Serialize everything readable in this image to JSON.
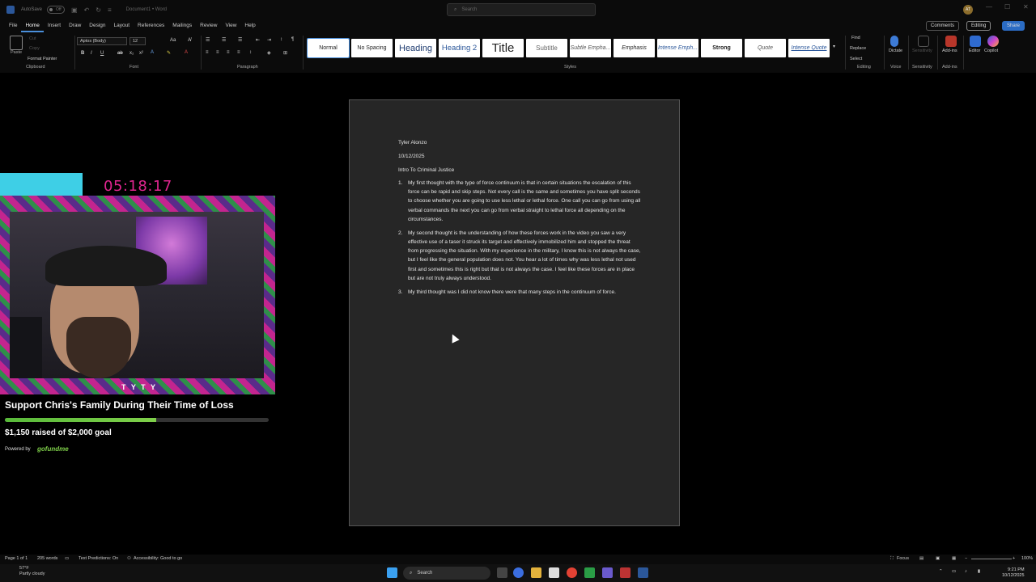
{
  "titlebar": {
    "autosave_label": "AutoSave",
    "autosave_state": "Off",
    "doc_title": "Document1 • Word",
    "search_placeholder": "Search",
    "user_initials": "AT"
  },
  "tabs": [
    "File",
    "Home",
    "Insert",
    "Draw",
    "Design",
    "Layout",
    "References",
    "Mailings",
    "Review",
    "View",
    "Help"
  ],
  "active_tab": "Home",
  "right_buttons": {
    "comments": "Comments",
    "editing": "Editing",
    "share": "Share"
  },
  "ribbon": {
    "paste": "Paste",
    "cut": "Cut",
    "copy": "Copy",
    "format_painter": "Format Painter",
    "clipboard_label": "Clipboard",
    "font_name": "Aptos (Body)",
    "font_size": "12",
    "font_label": "Font",
    "paragraph_label": "Paragraph",
    "styles_label": "Styles",
    "styles": [
      "Normal",
      "No Spacing",
      "Heading",
      "Heading 2",
      "Title",
      "Subtitle",
      "Subtle Empha...",
      "Emphasis",
      "Intense Emph...",
      "Strong",
      "Quote",
      "Intense Quote"
    ],
    "find": "Find",
    "replace": "Replace",
    "select": "Select",
    "editing_label": "Editing",
    "dictate": "Dictate",
    "voice_label": "Voice",
    "sensitivity": "Sensitivity",
    "sensitivity_label": "Sensitivity",
    "addins": "Add-ins",
    "addins_label": "Add-ins",
    "editor": "Editor",
    "copilot": "Copilot"
  },
  "document": {
    "name": "Tyler Alonzo",
    "date": "10/12/2025",
    "course": "Intro To Criminal Justice",
    "items": [
      {
        "num": "1.",
        "text": "My first thought with the type of force continuum is that in certain situations the escalation of this force can be rapid and skip steps. Not every call is the same and sometimes you have split seconds to choose whether you are going to use less lethal or lethal force. One call you can go from using all verbal commands the next you can go from verbal straight to lethal force all depending on the circumstances."
      },
      {
        "num": "2.",
        "text": "My second thought is the understanding of how these forces work in the video you saw a very effective use of a taser it struck its target and effectively immobilized him and stopped the threat from progressing the situation. With my experience in the military, I know this is not always the case, but I feel like the general population does not. You hear a lot of times why was less lethal not used first and sometimes this is right but that is not always the case. I feel like these forces are in place but are not truly always understood."
      },
      {
        "num": "3.",
        "text": "My third thought was I did not know there were that many steps in the continuum of force."
      }
    ]
  },
  "overlay": {
    "timer": "05:18:17",
    "fundraiser_title": "Support Chris's Family During Their Time of Loss",
    "raised_text": "$1,150 raised of $2,000 goal",
    "raised_fraction": 0.575,
    "powered_by": "Powered by",
    "logo": "gofundme",
    "cam_caption": "T Y T Y"
  },
  "statusbar": {
    "page": "Page 1 of 1",
    "words": "205 words",
    "text_predictions": "Text Predictions: On",
    "accessibility": "Accessibility: Good to go",
    "focus": "Focus",
    "zoom": "100%"
  },
  "taskbar": {
    "temp": "57°F",
    "weather": "Partly cloudy",
    "search": "Search",
    "time": "9:21 PM",
    "date": "10/12/2025"
  }
}
